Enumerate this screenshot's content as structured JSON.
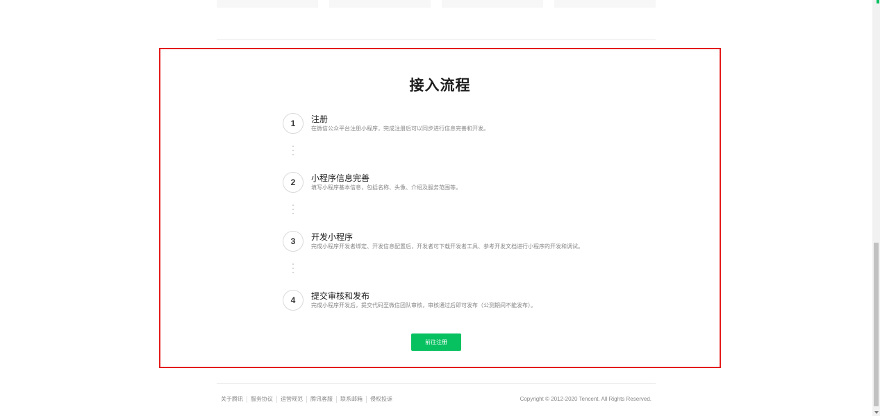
{
  "process": {
    "title": "接入流程",
    "steps": [
      {
        "number": "1",
        "title": "注册",
        "description": "在微信公众平台注册小程序，完成注册后可以同步进行信息完善和开发。"
      },
      {
        "number": "2",
        "title": "小程序信息完善",
        "description": "填写小程序基本信息，包括名称、头像、介绍及服务范围等。"
      },
      {
        "number": "3",
        "title": "开发小程序",
        "description": "完成小程序开发者绑定、开发信息配置后，开发者可下载开发者工具、参考开发文档进行小程序的开发和调试。"
      },
      {
        "number": "4",
        "title": "提交审核和发布",
        "description": "完成小程序开发后，提交代码至微信团队审核，审核通过后即可发布（公测期间不能发布）。"
      }
    ],
    "register_button": "前往注册"
  },
  "footer": {
    "links": [
      "关于腾讯",
      "服务协议",
      "运营规范",
      "腾讯客服",
      "联系邮箱",
      "侵权投诉"
    ],
    "copyright": "Copyright © 2012-2020 Tencent. All Rights Reserved."
  },
  "colors": {
    "accent": "#07c160",
    "highlight_border": "#e31b1b"
  }
}
